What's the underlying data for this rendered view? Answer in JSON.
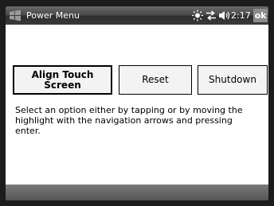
{
  "window": {
    "title": "Power Menu",
    "time": "2:17",
    "ok_label": "ok"
  },
  "status_icons": [
    "brightness-icon",
    "connectivity-icon",
    "volume-icon"
  ],
  "buttons": {
    "align_touch_screen": "Align Touch Screen",
    "reset": "Reset",
    "shutdown": "Shutdown"
  },
  "instructions": "Select an option either by tapping or by moving the highlight with the navigation arrows and pressing enter."
}
